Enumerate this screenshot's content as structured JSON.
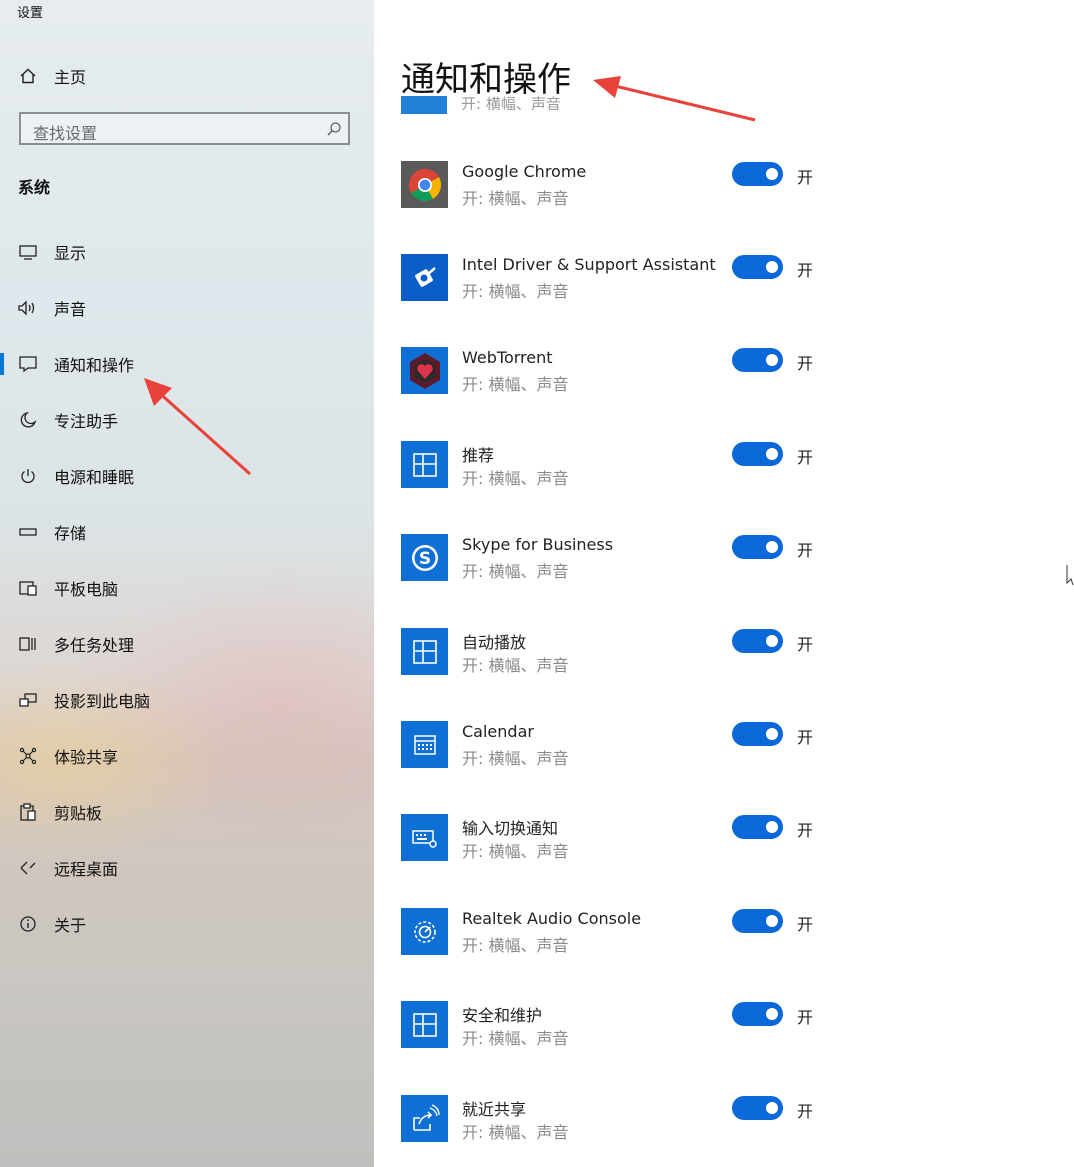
{
  "window": {
    "title": "设置"
  },
  "sidebar": {
    "home_label": "主页",
    "search": {
      "placeholder": "查找设置"
    },
    "section_title": "系统",
    "items": [
      {
        "label": "显示",
        "icon": "monitor-icon"
      },
      {
        "label": "声音",
        "icon": "speaker-icon"
      },
      {
        "label": "通知和操作",
        "icon": "notification-icon",
        "selected": true
      },
      {
        "label": "专注助手",
        "icon": "moon-icon"
      },
      {
        "label": "电源和睡眠",
        "icon": "power-icon"
      },
      {
        "label": "存储",
        "icon": "storage-icon"
      },
      {
        "label": "平板电脑",
        "icon": "tablet-icon"
      },
      {
        "label": "多任务处理",
        "icon": "multitasking-icon"
      },
      {
        "label": "投影到此电脑",
        "icon": "projecting-icon"
      },
      {
        "label": "体验共享",
        "icon": "shared-experiences-icon"
      },
      {
        "label": "剪贴板",
        "icon": "clipboard-icon"
      },
      {
        "label": "远程桌面",
        "icon": "remote-desktop-icon"
      },
      {
        "label": "关于",
        "icon": "info-icon"
      }
    ]
  },
  "main": {
    "title": "通知和操作",
    "partial_row_subtitle": "开: 横幅、声音",
    "apps": [
      {
        "name": "Google Chrome",
        "subtitle": "开: 横幅、声音",
        "toggle_state": "开",
        "icon": "chrome-icon"
      },
      {
        "name": "Intel Driver & Support Assistant",
        "subtitle": "开: 横幅、声音",
        "toggle_state": "开",
        "icon": "intel-dsa-icon"
      },
      {
        "name": "WebTorrent",
        "subtitle": "开: 横幅、声音",
        "toggle_state": "开",
        "icon": "webtorrent-icon"
      },
      {
        "name": "推荐",
        "subtitle": "开: 横幅、声音",
        "toggle_state": "开",
        "icon": "app-tile-icon"
      },
      {
        "name": "Skype for Business",
        "subtitle": "开: 横幅、声音",
        "toggle_state": "开",
        "icon": "skype-icon"
      },
      {
        "name": "自动播放",
        "subtitle": "开: 横幅、声音",
        "toggle_state": "开",
        "icon": "app-tile-icon"
      },
      {
        "name": "Calendar",
        "subtitle": "开: 横幅、声音",
        "toggle_state": "开",
        "icon": "calendar-icon"
      },
      {
        "name": "输入切换通知",
        "subtitle": "开: 横幅、声音",
        "toggle_state": "开",
        "icon": "keyboard-settings-icon"
      },
      {
        "name": "Realtek Audio Console",
        "subtitle": "开: 横幅、声音",
        "toggle_state": "开",
        "icon": "realtek-icon"
      },
      {
        "name": "安全和维护",
        "subtitle": "开: 横幅、声音",
        "toggle_state": "开",
        "icon": "app-tile-icon"
      },
      {
        "name": "就近共享",
        "subtitle": "开: 横幅、声音",
        "toggle_state": "开",
        "icon": "nearby-sharing-icon"
      }
    ]
  },
  "colors": {
    "accent": "#0078d4",
    "toggle_on": "#0a68d9",
    "annotation_arrow": "#e8423a"
  }
}
